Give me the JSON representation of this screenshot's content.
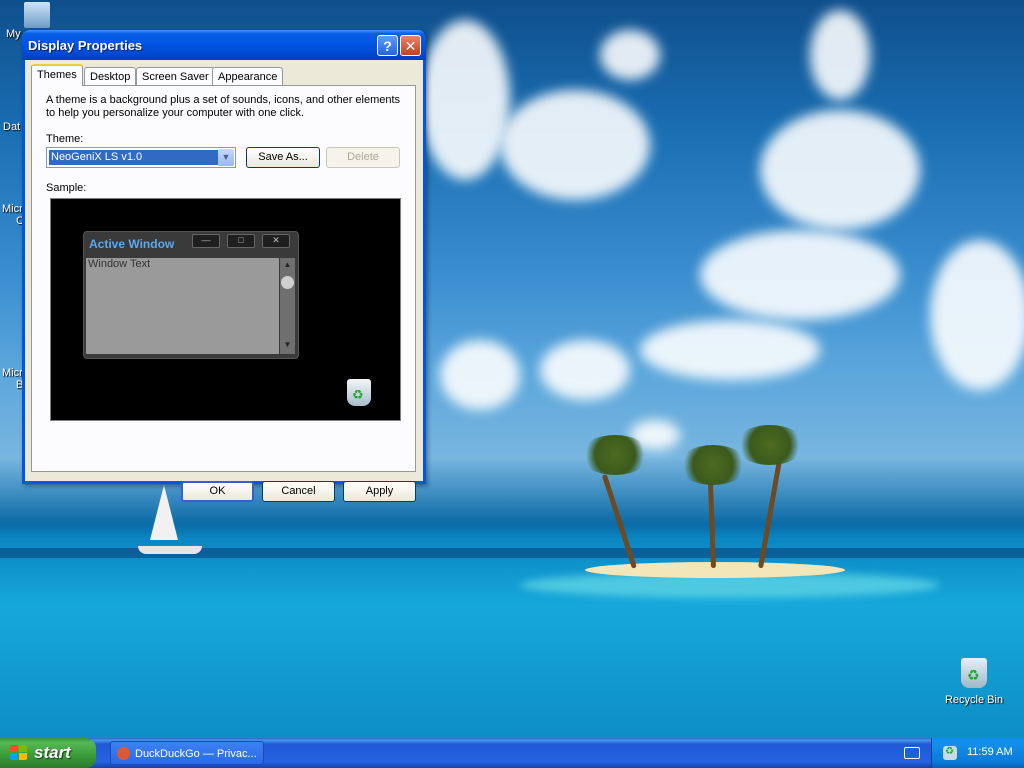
{
  "desktop": {
    "icons": [
      {
        "label": "My"
      },
      {
        "label": "Dat"
      },
      {
        "label": "Micr"
      },
      {
        "label": "C"
      },
      {
        "label": "Micr"
      },
      {
        "label": "B"
      }
    ],
    "recycle_bin_label": "Recycle Bin"
  },
  "dialog": {
    "title": "Display Properties",
    "help_symbol": "?",
    "close_symbol": "✕",
    "tabs": [
      {
        "label": "Themes",
        "active": true
      },
      {
        "label": "Desktop"
      },
      {
        "label": "Screen Saver"
      },
      {
        "label": "Appearance"
      }
    ],
    "description": "A theme is a background plus a set of sounds, icons, and other elements to help you personalize your computer with one click.",
    "theme_label": "Theme:",
    "theme_value": "NeoGeniX LS v1.0",
    "save_as_label": "Save As...",
    "delete_label": "Delete",
    "sample_label": "Sample:",
    "preview": {
      "window_title": "Active Window",
      "window_text": "Window Text",
      "min_symbol": "—",
      "max_symbol": "□",
      "close_symbol": "✕"
    },
    "ok_label": "OK",
    "cancel_label": "Cancel",
    "apply_label": "Apply"
  },
  "taskbar": {
    "start_label": "start",
    "task_item_label": "DuckDuckGo — Privac...",
    "clock": "11:59 AM"
  },
  "colors": {
    "xp_blue": "#0055e5",
    "selection": "#316ac5",
    "start_green": "#3a9a3a",
    "tab_highlight": "#ffc83c"
  }
}
